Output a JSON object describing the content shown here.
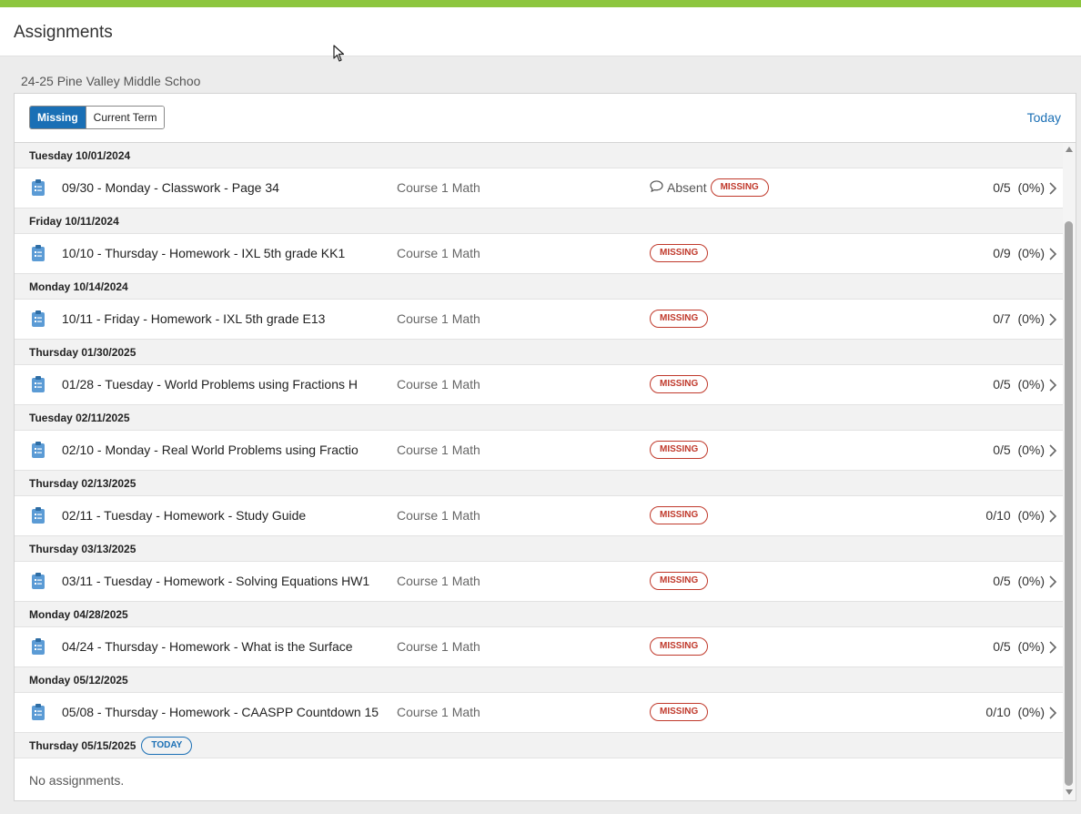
{
  "header": {
    "title": "Assignments"
  },
  "school": "24-25 Pine Valley Middle Schoo",
  "toolbar": {
    "tabs": [
      {
        "label": "Missing",
        "active": true
      },
      {
        "label": "Current Term",
        "active": false
      }
    ],
    "today_link": "Today"
  },
  "colors": {
    "accent_bar": "#8dc63f",
    "primary": "#1a6fb5",
    "missing": "#c0392b"
  },
  "groups": [
    {
      "date": "Tuesday 10/01/2024",
      "items": [
        {
          "name": "09/30 - Monday - Classwork - Page 34",
          "course": "Course 1 Math",
          "absent": "Absent",
          "status": "MISSING",
          "score": "0/5",
          "percent": "(0%)"
        }
      ]
    },
    {
      "date": "Friday 10/11/2024",
      "items": [
        {
          "name": "10/10 - Thursday - Homework - IXL 5th grade KK1",
          "course": "Course 1 Math",
          "status": "MISSING",
          "score": "0/9",
          "percent": "(0%)"
        }
      ]
    },
    {
      "date": "Monday 10/14/2024",
      "items": [
        {
          "name": "10/11 - Friday - Homework - IXL 5th grade E13",
          "course": "Course 1 Math",
          "status": "MISSING",
          "score": "0/7",
          "percent": "(0%)"
        }
      ]
    },
    {
      "date": "Thursday 01/30/2025",
      "items": [
        {
          "name": "01/28 - Tuesday - World Problems using Fractions H",
          "course": "Course 1 Math",
          "status": "MISSING",
          "score": "0/5",
          "percent": "(0%)"
        }
      ]
    },
    {
      "date": "Tuesday 02/11/2025",
      "items": [
        {
          "name": "02/10 - Monday - Real World Problems using Fractio",
          "course": "Course 1 Math",
          "status": "MISSING",
          "score": "0/5",
          "percent": "(0%)"
        }
      ]
    },
    {
      "date": "Thursday 02/13/2025",
      "items": [
        {
          "name": "02/11 - Tuesday - Homework - Study Guide",
          "course": "Course 1 Math",
          "status": "MISSING",
          "score": "0/10",
          "percent": "(0%)"
        }
      ]
    },
    {
      "date": "Thursday 03/13/2025",
      "items": [
        {
          "name": "03/11 - Tuesday - Homework - Solving Equations HW1",
          "course": "Course 1 Math",
          "status": "MISSING",
          "score": "0/5",
          "percent": "(0%)"
        }
      ]
    },
    {
      "date": "Monday 04/28/2025",
      "items": [
        {
          "name": "04/24 - Thursday - Homework - What is the Surface",
          "course": "Course 1 Math",
          "status": "MISSING",
          "score": "0/5",
          "percent": "(0%)"
        }
      ]
    },
    {
      "date": "Monday 05/12/2025",
      "items": [
        {
          "name": "05/08 - Thursday - Homework - CAASPP Countdown 15",
          "course": "Course 1 Math",
          "status": "MISSING",
          "score": "0/10",
          "percent": "(0%)"
        }
      ]
    }
  ],
  "today_group": {
    "date": "Thursday 05/15/2025",
    "badge": "TODAY",
    "empty_text": "No assignments."
  }
}
